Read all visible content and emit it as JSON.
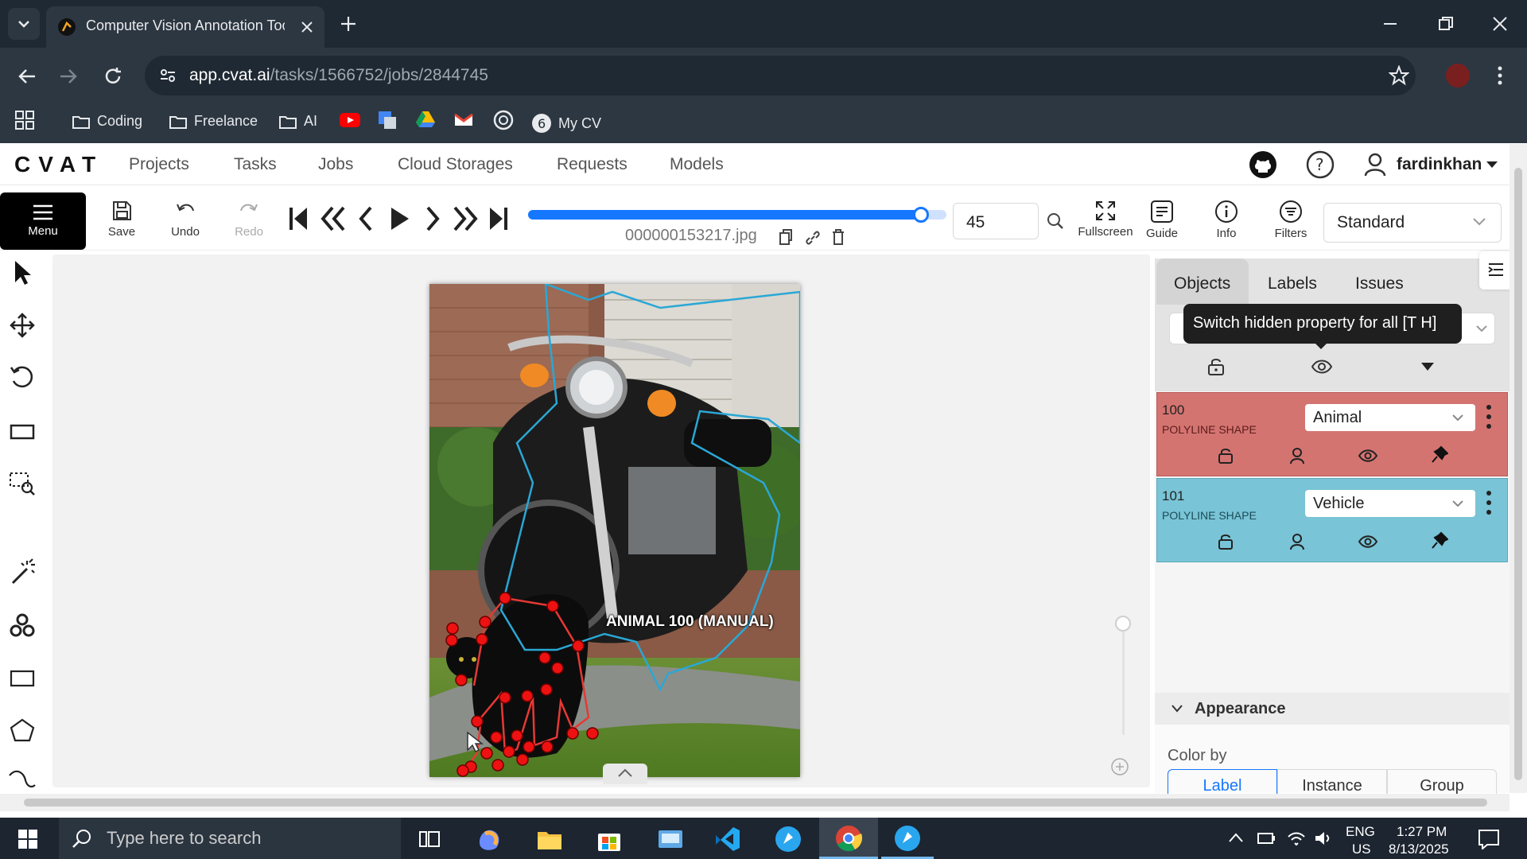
{
  "browser": {
    "tab_title": "Computer Vision Annotation Tool",
    "url_host": "app.cvat.ai",
    "url_path": "/tasks/1566752/jobs/2844745",
    "bookmarks": [
      "Coding",
      "Freelance",
      "AI",
      "My CV"
    ]
  },
  "app": {
    "logo": "CVAT",
    "nav": [
      "Projects",
      "Tasks",
      "Jobs",
      "Cloud Storages",
      "Requests",
      "Models"
    ],
    "username": "fardinkhan"
  },
  "toolbar": {
    "menu_label": "Menu",
    "save_label": "Save",
    "undo_label": "Undo",
    "redo_label": "Redo",
    "frame_number": "45",
    "filename": "000000153217.jpg",
    "frame_progress": 0.94,
    "fullscreen_label": "Fullscreen",
    "guide_label": "Guide",
    "info_label": "Info",
    "filters_label": "Filters",
    "workspace": "Standard"
  },
  "canvas": {
    "shape_label": "ANIMAL 100 (MANUAL)"
  },
  "sidebar": {
    "tabs": [
      "Objects",
      "Labels",
      "Issues"
    ],
    "tooltip": "Switch hidden property for all [T H]",
    "objects": [
      {
        "id": "100",
        "type": "POLYLINE SHAPE",
        "label": "Animal",
        "color": "#d47471"
      },
      {
        "id": "101",
        "type": "POLYLINE SHAPE",
        "label": "Vehicle",
        "color": "#79c4d6"
      }
    ],
    "appearance": {
      "title": "Appearance",
      "color_by_label": "Color by",
      "options": [
        "Label",
        "Instance",
        "Group"
      ],
      "selected": "Label"
    }
  },
  "taskbar": {
    "search_placeholder": "Type here to search",
    "lang": "ENG",
    "region": "US",
    "time": "1:27 PM",
    "date": "8/13/2025"
  }
}
